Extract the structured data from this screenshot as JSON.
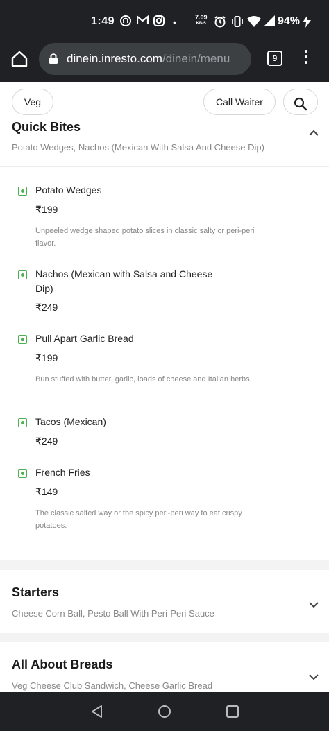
{
  "status_bar": {
    "time": "1:49",
    "net_speed_value": "7.09",
    "net_speed_unit": "KB/S",
    "battery": "94%",
    "icons": [
      "notification-icon",
      "gmail-icon",
      "instagram-icon",
      "dot-icon",
      "alarm-icon",
      "vibrate-icon",
      "wifi-icon",
      "signal-icon",
      "charging-icon"
    ]
  },
  "browser": {
    "url_host": "dinein.inresto.com",
    "url_path": "/dinein/menu",
    "tab_count": "9"
  },
  "toolbar": {
    "veg_label": "Veg",
    "call_waiter_label": "Call Waiter"
  },
  "sections": [
    {
      "title": "Quick Bites",
      "subtitle": "Potato Wedges, Nachos (Mexican With Salsa And Cheese Dip)",
      "expanded": true,
      "items": [
        {
          "name": "Potato Wedges",
          "price": "₹199",
          "description": "Unpeeled wedge shaped potato slices in classic salty or peri-peri flavor."
        },
        {
          "name": "Nachos (Mexican with Salsa and Cheese Dip)",
          "price": "₹249",
          "description": ""
        },
        {
          "name": "Pull Apart Garlic Bread",
          "price": "₹199",
          "description": "Bun stuffed with butter, garlic, loads of cheese and Italian herbs."
        },
        {
          "name": "Tacos (Mexican)",
          "price": "₹249",
          "description": ""
        },
        {
          "name": "French Fries",
          "price": "₹149",
          "description": "The classic salted way or the spicy peri-peri way to eat crispy potatoes."
        }
      ]
    },
    {
      "title": "Starters",
      "subtitle": "Cheese Corn Ball, Pesto Ball With Peri-Peri Sauce",
      "expanded": false
    },
    {
      "title": "All About Breads",
      "subtitle": "Veg Cheese Club Sandwich, Cheese Garlic Bread",
      "expanded": false
    }
  ],
  "colors": {
    "system_bar": "#202124",
    "veg_green": "#4caf50",
    "muted_text": "#888888"
  }
}
